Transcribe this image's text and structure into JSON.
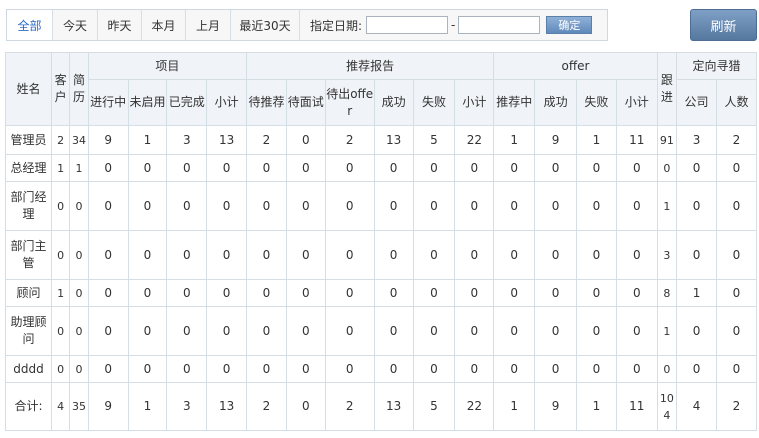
{
  "filters": {
    "tabs": [
      "全部",
      "今天",
      "昨天",
      "本月",
      "上月",
      "最近30天"
    ],
    "date_label": "指定日期:",
    "date_from": "",
    "date_to": "",
    "separator": "-",
    "confirm": "确定"
  },
  "refresh": "刷新",
  "table": {
    "headers": {
      "name": "姓名",
      "customer": "客户",
      "resume": "简历",
      "project_group": "项目",
      "project": [
        "进行中",
        "未启用",
        "已完成",
        "小计"
      ],
      "report_group": "推荐报告",
      "report": [
        "待推荐",
        "待面试",
        "待出offer",
        "成功",
        "失败",
        "小计"
      ],
      "offer_group": "offer",
      "offer": [
        "推荐中",
        "成功",
        "失败",
        "小计"
      ],
      "followup": "跟进",
      "directed_group": "定向寻猎",
      "directed": [
        "公司",
        "人数"
      ]
    },
    "rows": [
      {
        "name": "管理员",
        "v": [
          "2",
          "34",
          "9",
          "1",
          "3",
          "13",
          "2",
          "0",
          "2",
          "13",
          "5",
          "22",
          "1",
          "9",
          "1",
          "11",
          "91",
          "3",
          "2"
        ]
      },
      {
        "name": "总经理",
        "v": [
          "1",
          "1",
          "0",
          "0",
          "0",
          "0",
          "0",
          "0",
          "0",
          "0",
          "0",
          "0",
          "0",
          "0",
          "0",
          "0",
          "0",
          "0",
          "0"
        ]
      },
      {
        "name": "部门经理",
        "v": [
          "0",
          "0",
          "0",
          "0",
          "0",
          "0",
          "0",
          "0",
          "0",
          "0",
          "0",
          "0",
          "0",
          "0",
          "0",
          "0",
          "1",
          "0",
          "0"
        ]
      },
      {
        "name": "部门主管",
        "v": [
          "0",
          "0",
          "0",
          "0",
          "0",
          "0",
          "0",
          "0",
          "0",
          "0",
          "0",
          "0",
          "0",
          "0",
          "0",
          "0",
          "3",
          "0",
          "0"
        ]
      },
      {
        "name": "顾问",
        "v": [
          "1",
          "0",
          "0",
          "0",
          "0",
          "0",
          "0",
          "0",
          "0",
          "0",
          "0",
          "0",
          "0",
          "0",
          "0",
          "0",
          "8",
          "1",
          "0"
        ]
      },
      {
        "name": "助理顾问",
        "v": [
          "0",
          "0",
          "0",
          "0",
          "0",
          "0",
          "0",
          "0",
          "0",
          "0",
          "0",
          "0",
          "0",
          "0",
          "0",
          "0",
          "1",
          "0",
          "0"
        ]
      },
      {
        "name": "dddd",
        "v": [
          "0",
          "0",
          "0",
          "0",
          "0",
          "0",
          "0",
          "0",
          "0",
          "0",
          "0",
          "0",
          "0",
          "0",
          "0",
          "0",
          "0",
          "0",
          "0"
        ]
      }
    ],
    "total": {
      "name": "合计:",
      "v": [
        "4",
        "35",
        "9",
        "1",
        "3",
        "13",
        "2",
        "0",
        "2",
        "13",
        "5",
        "22",
        "1",
        "9",
        "1",
        "11",
        "104",
        "4",
        "2"
      ]
    }
  }
}
